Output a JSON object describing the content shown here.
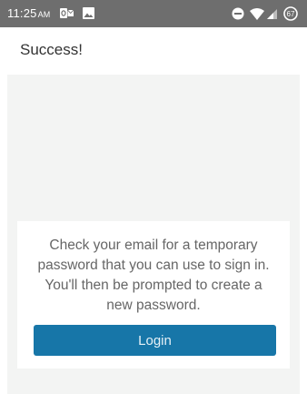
{
  "status_bar": {
    "time": "11:25",
    "am_pm": "AM",
    "icons": [
      "outlook-icon",
      "image-icon",
      "do-not-disturb-icon",
      "wifi-icon",
      "signal-icon",
      "battery-icon"
    ],
    "background_color": "#6e6e6e"
  },
  "header": {
    "title": "Success!"
  },
  "card": {
    "message": "Check your email for a temporary password that you can use to sign in. You'll then be prompted to create a new password.",
    "login_label": "Login"
  },
  "colors": {
    "accent": "#1776a8",
    "content_background": "#f3f4f3",
    "text": "#666666"
  }
}
